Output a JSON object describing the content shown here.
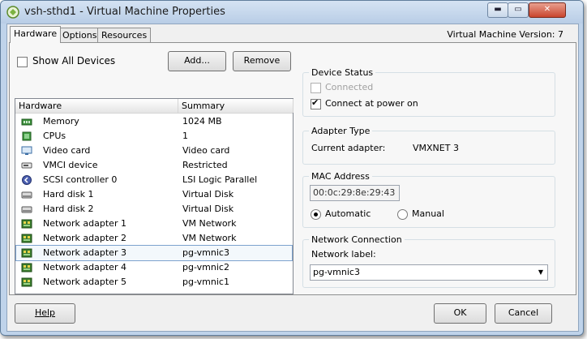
{
  "window": {
    "title": "vsh-sthd1 - Virtual Machine Properties",
    "controls": {
      "minimize": "▬",
      "maximize": "▭",
      "close": "✕"
    }
  },
  "tabs": [
    {
      "label": "Hardware",
      "active": true
    },
    {
      "label": "Options",
      "active": false
    },
    {
      "label": "Resources",
      "active": false
    }
  ],
  "vm_version": "Virtual Machine Version: 7",
  "show_all_devices": {
    "label": "Show All Devices",
    "checked": false
  },
  "add_button": "Add...",
  "remove_button": "Remove",
  "hardware_list": {
    "columns": [
      "Hardware",
      "Summary"
    ],
    "rows": [
      {
        "icon": "memory-icon",
        "name": "Memory",
        "summary": "1024 MB",
        "selected": false
      },
      {
        "icon": "cpu-icon",
        "name": "CPUs",
        "summary": "1",
        "selected": false
      },
      {
        "icon": "video-card-icon",
        "name": "Video card",
        "summary": "Video card",
        "selected": false
      },
      {
        "icon": "vmci-device-icon",
        "name": "VMCI device",
        "summary": "Restricted",
        "selected": false
      },
      {
        "icon": "scsi-controller-icon",
        "name": "SCSI controller 0",
        "summary": "LSI Logic Parallel",
        "selected": false
      },
      {
        "icon": "hard-disk-icon",
        "name": "Hard disk 1",
        "summary": "Virtual Disk",
        "selected": false
      },
      {
        "icon": "hard-disk-icon",
        "name": "Hard disk 2",
        "summary": "Virtual Disk",
        "selected": false
      },
      {
        "icon": "network-adapter-icon",
        "name": "Network adapter 1",
        "summary": "VM Network",
        "selected": false
      },
      {
        "icon": "network-adapter-icon",
        "name": "Network adapter 2",
        "summary": "VM Network",
        "selected": false
      },
      {
        "icon": "network-adapter-icon",
        "name": "Network adapter 3",
        "summary": "pg-vmnic3",
        "selected": true
      },
      {
        "icon": "network-adapter-icon",
        "name": "Network adapter 4",
        "summary": "pg-vmnic2",
        "selected": false
      },
      {
        "icon": "network-adapter-icon",
        "name": "Network adapter 5",
        "summary": "pg-vmnic1",
        "selected": false
      }
    ]
  },
  "device_status": {
    "legend": "Device Status",
    "connected": {
      "label": "Connected",
      "checked": false,
      "enabled": false
    },
    "connect_at_power_on": {
      "label": "Connect at power on",
      "checked": true
    }
  },
  "adapter_type": {
    "legend": "Adapter Type",
    "label": "Current adapter:",
    "value": "VMXNET 3"
  },
  "mac_address": {
    "legend": "MAC Address",
    "value": "00:0c:29:8e:29:43",
    "automatic_label": "Automatic",
    "manual_label": "Manual",
    "selected": "automatic"
  },
  "network_connection": {
    "legend": "Network Connection",
    "label": "Network label:",
    "value": "pg-vmnic3"
  },
  "help_button": "Help",
  "ok_button": "OK",
  "cancel_button": "Cancel",
  "colors": {
    "titlebar": "#c8d9ee",
    "selection_border": "#7da2ce",
    "panel": "#f7f7f7"
  }
}
